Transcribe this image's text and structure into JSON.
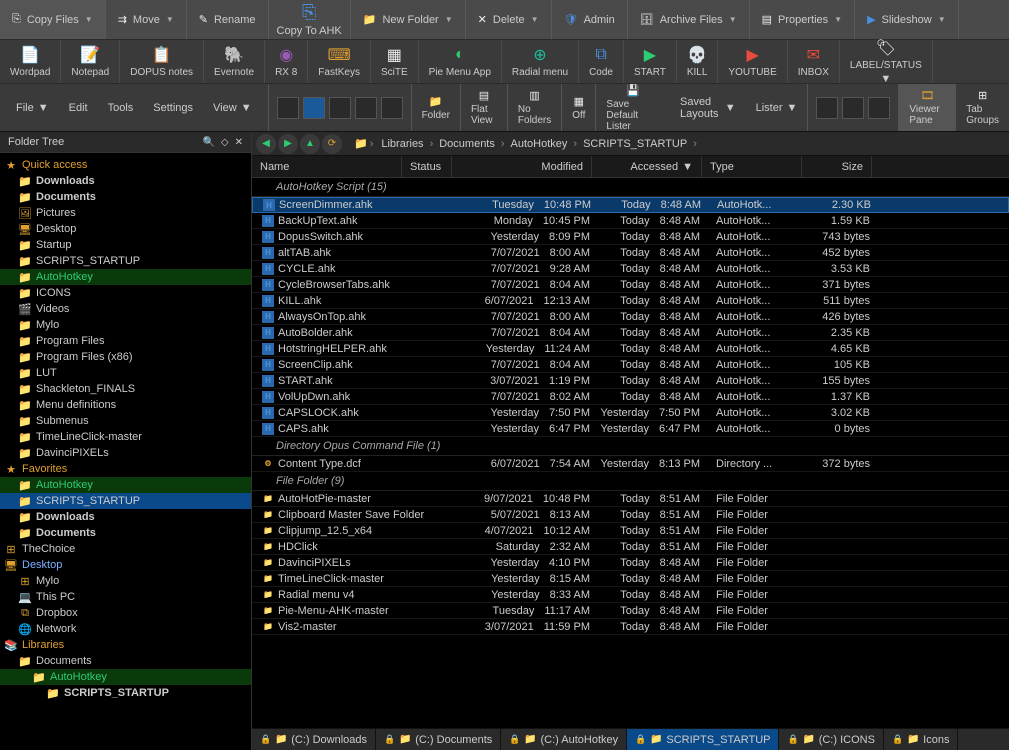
{
  "ribbon1": {
    "copy_files": "Copy Files",
    "move": "Move",
    "rename": "Rename",
    "copy_to_ahk": "Copy To AHK",
    "new_folder": "New Folder",
    "delete": "Delete",
    "admin": "Admin",
    "archive_files": "Archive Files",
    "properties": "Properties",
    "slideshow": "Slideshow"
  },
  "ribbon2": {
    "wordpad": "Wordpad",
    "notepad": "Notepad",
    "dopus_notes": "DOPUS notes",
    "evernote": "Evernote",
    "rx8": "RX 8",
    "fastkeys": "FastKeys",
    "scite": "SciTE",
    "pie_menu_app": "Pie Menu App",
    "radial_menu": "Radial menu",
    "code": "Code",
    "start": "START",
    "kill": "KILL",
    "youtube": "YOUTUBE",
    "inbox": "INBOX",
    "label_status": "LABEL/STATUS"
  },
  "ribbon3": {
    "file": "File",
    "edit": "Edit",
    "tools": "Tools",
    "settings": "Settings",
    "view": "View",
    "folder": "Folder",
    "flat_view": "Flat View",
    "no_folders": "No Folders",
    "off": "Off",
    "save_default": "Save Default Lister",
    "saved_layouts": "Saved Layouts",
    "lister": "Lister",
    "viewer_pane": "Viewer Pane",
    "tab_groups": "Tab Groups"
  },
  "tree_title": "Folder Tree",
  "tree": [
    {
      "d": 0,
      "ic": "star",
      "txt": "Quick access",
      "cls": "startxt"
    },
    {
      "d": 1,
      "ic": "folder-b",
      "txt": "Downloads",
      "b": true
    },
    {
      "d": 1,
      "ic": "folder-b",
      "txt": "Documents",
      "b": true
    },
    {
      "d": 1,
      "ic": "pic",
      "txt": "Pictures"
    },
    {
      "d": 1,
      "ic": "desk",
      "txt": "Desktop"
    },
    {
      "d": 1,
      "ic": "folder",
      "txt": "Startup"
    },
    {
      "d": 1,
      "ic": "folder",
      "txt": "SCRIPTS_STARTUP"
    },
    {
      "d": 1,
      "ic": "folder",
      "txt": "AutoHotkey",
      "cls": "hl"
    },
    {
      "d": 1,
      "ic": "folder",
      "txt": "ICONS"
    },
    {
      "d": 1,
      "ic": "vid",
      "txt": "Videos"
    },
    {
      "d": 1,
      "ic": "folder",
      "txt": "Mylo"
    },
    {
      "d": 1,
      "ic": "folder",
      "txt": "Program Files"
    },
    {
      "d": 1,
      "ic": "folder",
      "txt": "Program Files (x86)"
    },
    {
      "d": 1,
      "ic": "folder",
      "txt": "LUT"
    },
    {
      "d": 1,
      "ic": "folder",
      "txt": "Shackleton_FINALS"
    },
    {
      "d": 1,
      "ic": "folder",
      "txt": "Menu definitions"
    },
    {
      "d": 1,
      "ic": "folder",
      "txt": "Submenus"
    },
    {
      "d": 1,
      "ic": "folder",
      "txt": "TimeLineClick-master"
    },
    {
      "d": 1,
      "ic": "folder",
      "txt": "DavinciPIXELs"
    },
    {
      "d": 0,
      "ic": "star",
      "txt": "Favorites",
      "cls": "startxt"
    },
    {
      "d": 1,
      "ic": "folder",
      "txt": "AutoHotkey",
      "cls": "hl"
    },
    {
      "d": 1,
      "ic": "folder",
      "txt": "SCRIPTS_STARTUP",
      "sel": true
    },
    {
      "d": 1,
      "ic": "folder-b",
      "txt": "Downloads",
      "b": true
    },
    {
      "d": 1,
      "ic": "folder-b",
      "txt": "Documents",
      "b": true
    },
    {
      "d": 0,
      "ic": "plus",
      "txt": "TheChoice"
    },
    {
      "d": 0,
      "ic": "desk",
      "txt": "Desktop",
      "cls": "bluetxt",
      "pre": ""
    },
    {
      "d": 1,
      "ic": "plus",
      "txt": "Mylo"
    },
    {
      "d": 1,
      "ic": "pc",
      "txt": "This PC"
    },
    {
      "d": 1,
      "ic": "db",
      "txt": "Dropbox"
    },
    {
      "d": 1,
      "ic": "net",
      "txt": "Network"
    },
    {
      "d": 0,
      "ic": "lib",
      "txt": "Libraries",
      "cls": "startxt"
    },
    {
      "d": 1,
      "ic": "folder-b",
      "txt": "Documents"
    },
    {
      "d": 2,
      "ic": "folder",
      "txt": "AutoHotkey",
      "cls": "hl"
    },
    {
      "d": 3,
      "ic": "folder",
      "txt": "SCRIPTS_STARTUP",
      "b": true
    }
  ],
  "breadcrumb": [
    "Libraries",
    "Documents",
    "AutoHotkey",
    "SCRIPTS_STARTUP"
  ],
  "columns": {
    "name": "Name",
    "status": "Status",
    "modified": "Modified",
    "accessed": "Accessed",
    "type": "Type",
    "size": "Size"
  },
  "groups": [
    {
      "label": "AutoHotkey Script (15)",
      "icon": "ahk",
      "rows": [
        {
          "name": "ScreenDimmer.ahk",
          "mod_d": "Tuesday",
          "mod_t": "10:48 PM",
          "acc_d": "Today",
          "acc_t": "8:48 AM",
          "type": "AutoHotk...",
          "size": "2.30 KB",
          "sel": true
        },
        {
          "name": "BackUpText.ahk",
          "mod_d": "Monday",
          "mod_t": "10:45 PM",
          "acc_d": "Today",
          "acc_t": "8:48 AM",
          "type": "AutoHotk...",
          "size": "1.59 KB"
        },
        {
          "name": "DopusSwitch.ahk",
          "mod_d": "Yesterday",
          "mod_t": "8:09 PM",
          "acc_d": "Today",
          "acc_t": "8:48 AM",
          "type": "AutoHotk...",
          "size": "743 bytes"
        },
        {
          "name": "altTAB.ahk",
          "mod_d": "7/07/2021",
          "mod_t": "8:00 AM",
          "acc_d": "Today",
          "acc_t": "8:48 AM",
          "type": "AutoHotk...",
          "size": "452 bytes"
        },
        {
          "name": "CYCLE.ahk",
          "mod_d": "7/07/2021",
          "mod_t": "9:28 AM",
          "acc_d": "Today",
          "acc_t": "8:48 AM",
          "type": "AutoHotk...",
          "size": "3.53 KB"
        },
        {
          "name": "CycleBrowserTabs.ahk",
          "mod_d": "7/07/2021",
          "mod_t": "8:04 AM",
          "acc_d": "Today",
          "acc_t": "8:48 AM",
          "type": "AutoHotk...",
          "size": "371 bytes"
        },
        {
          "name": "KILL.ahk",
          "mod_d": "6/07/2021",
          "mod_t": "12:13 AM",
          "acc_d": "Today",
          "acc_t": "8:48 AM",
          "type": "AutoHotk...",
          "size": "511 bytes"
        },
        {
          "name": "AlwaysOnTop.ahk",
          "mod_d": "7/07/2021",
          "mod_t": "8:00 AM",
          "acc_d": "Today",
          "acc_t": "8:48 AM",
          "type": "AutoHotk...",
          "size": "426 bytes"
        },
        {
          "name": "AutoBolder.ahk",
          "mod_d": "7/07/2021",
          "mod_t": "8:04 AM",
          "acc_d": "Today",
          "acc_t": "8:48 AM",
          "type": "AutoHotk...",
          "size": "2.35 KB"
        },
        {
          "name": "HotstringHELPER.ahk",
          "mod_d": "Yesterday",
          "mod_t": "11:24 AM",
          "acc_d": "Today",
          "acc_t": "8:48 AM",
          "type": "AutoHotk...",
          "size": "4.65 KB"
        },
        {
          "name": "ScreenClip.ahk",
          "mod_d": "7/07/2021",
          "mod_t": "8:04 AM",
          "acc_d": "Today",
          "acc_t": "8:48 AM",
          "type": "AutoHotk...",
          "size": "105 KB"
        },
        {
          "name": "START.ahk",
          "mod_d": "3/07/2021",
          "mod_t": "1:19 PM",
          "acc_d": "Today",
          "acc_t": "8:48 AM",
          "type": "AutoHotk...",
          "size": "155 bytes"
        },
        {
          "name": "VolUpDwn.ahk",
          "mod_d": "7/07/2021",
          "mod_t": "8:02 AM",
          "acc_d": "Today",
          "acc_t": "8:48 AM",
          "type": "AutoHotk...",
          "size": "1.37 KB"
        },
        {
          "name": "CAPSLOCK.ahk",
          "mod_d": "Yesterday",
          "mod_t": "7:50 PM",
          "acc_d": "Yesterday",
          "acc_t": "7:50 PM",
          "type": "AutoHotk...",
          "size": "3.02 KB"
        },
        {
          "name": "CAPS.ahk",
          "mod_d": "Yesterday",
          "mod_t": "6:47 PM",
          "acc_d": "Yesterday",
          "acc_t": "6:47 PM",
          "type": "AutoHotk...",
          "size": "0 bytes"
        }
      ]
    },
    {
      "label": "Directory Opus Command File (1)",
      "icon": "dcf",
      "rows": [
        {
          "name": "Content Type.dcf",
          "mod_d": "6/07/2021",
          "mod_t": "7:54 AM",
          "acc_d": "Yesterday",
          "acc_t": "8:13 PM",
          "type": "Directory ...",
          "size": "372 bytes"
        }
      ]
    },
    {
      "label": "File Folder (9)",
      "icon": "folder",
      "rows": [
        {
          "name": "AutoHotPie-master",
          "mod_d": "9/07/2021",
          "mod_t": "10:48 PM",
          "acc_d": "Today",
          "acc_t": "8:51 AM",
          "type": "File Folder",
          "size": ""
        },
        {
          "name": "Clipboard Master Save Folder",
          "mod_d": "5/07/2021",
          "mod_t": "8:13 AM",
          "acc_d": "Today",
          "acc_t": "8:51 AM",
          "type": "File Folder",
          "size": ""
        },
        {
          "name": "Clipjump_12.5_x64",
          "mod_d": "4/07/2021",
          "mod_t": "10:12 AM",
          "acc_d": "Today",
          "acc_t": "8:51 AM",
          "type": "File Folder",
          "size": ""
        },
        {
          "name": "HDClick",
          "mod_d": "Saturday",
          "mod_t": "2:32 AM",
          "acc_d": "Today",
          "acc_t": "8:51 AM",
          "type": "File Folder",
          "size": ""
        },
        {
          "name": "DavinciPIXELs",
          "mod_d": "Yesterday",
          "mod_t": "4:10 PM",
          "acc_d": "Today",
          "acc_t": "8:48 AM",
          "type": "File Folder",
          "size": ""
        },
        {
          "name": "TimeLineClick-master",
          "mod_d": "Yesterday",
          "mod_t": "8:15 AM",
          "acc_d": "Today",
          "acc_t": "8:48 AM",
          "type": "File Folder",
          "size": ""
        },
        {
          "name": "Radial menu v4",
          "mod_d": "Yesterday",
          "mod_t": "8:33 AM",
          "acc_d": "Today",
          "acc_t": "8:48 AM",
          "type": "File Folder",
          "size": ""
        },
        {
          "name": "Pie-Menu-AHK-master",
          "mod_d": "Tuesday",
          "mod_t": "11:17 AM",
          "acc_d": "Today",
          "acc_t": "8:48 AM",
          "type": "File Folder",
          "size": ""
        },
        {
          "name": "Vis2-master",
          "mod_d": "3/07/2021",
          "mod_t": "11:59 PM",
          "acc_d": "Today",
          "acc_t": "8:48 AM",
          "type": "File Folder",
          "size": ""
        }
      ]
    }
  ],
  "tabs": [
    {
      "label": "(C:) Downloads",
      "active": false
    },
    {
      "label": "(C:) Documents",
      "active": false
    },
    {
      "label": "(C:) AutoHotkey",
      "active": false
    },
    {
      "label": "SCRIPTS_STARTUP",
      "active": true
    },
    {
      "label": "(C:) ICONS",
      "active": false
    },
    {
      "label": "Icons",
      "active": false
    }
  ]
}
